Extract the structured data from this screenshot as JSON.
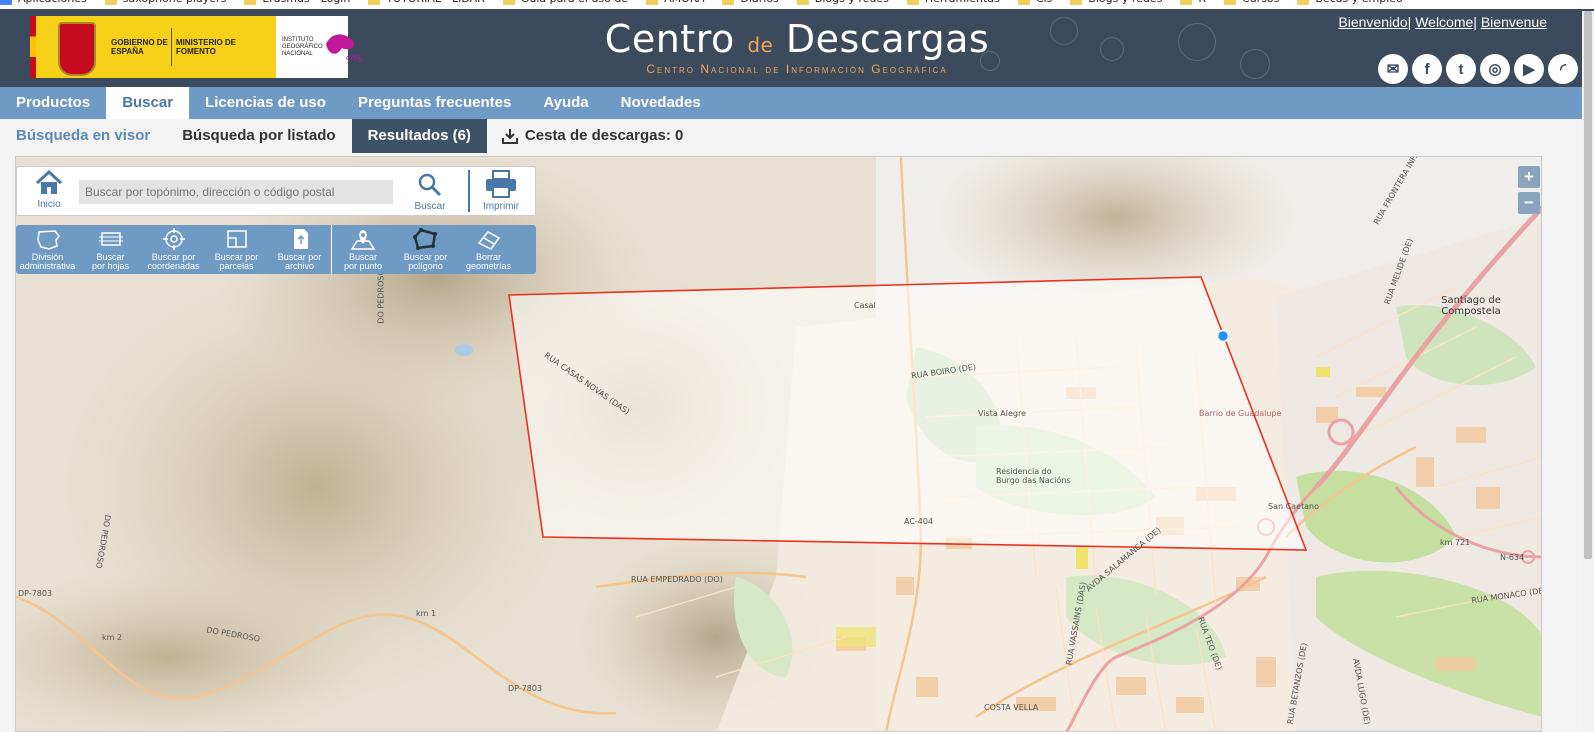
{
  "bookmarks": [
    "Aplicaciones",
    "saxophone players",
    "Erasmus - Login",
    "TUTORIAL - LIDAR",
    "Guía para el uso de",
    "AMORA",
    "Diarios",
    "Blogs y redes",
    "Herramientas",
    "Cis",
    "Blogs y redes",
    "R",
    "Cursos",
    "Becas y empleo"
  ],
  "header": {
    "logo_gobierno": "GOBIERNO DE ESPAÑA",
    "logo_ministerio": "MINISTERIO DE FOMENTO",
    "logo_ign": "INSTITUTO GEOGRÁFICO NACIONAL",
    "logo_cnig": "cnig",
    "title_a": "Centro",
    "title_de": "de",
    "title_b": "Descargas",
    "subtitle": "Centro Nacional de Información Geográfica",
    "languages": [
      "Bienvenido",
      "Welcome",
      "Bienvenue"
    ],
    "social": [
      {
        "icon": "mail-icon",
        "glyph": "✉"
      },
      {
        "icon": "facebook-icon",
        "glyph": "f"
      },
      {
        "icon": "twitter-icon",
        "glyph": "t"
      },
      {
        "icon": "instagram-icon",
        "glyph": "◎"
      },
      {
        "icon": "youtube-icon",
        "glyph": "▶"
      },
      {
        "icon": "rss-icon",
        "glyph": "◜"
      }
    ]
  },
  "mainnav": [
    {
      "label": "Productos",
      "active": false
    },
    {
      "label": "Buscar",
      "active": true
    },
    {
      "label": "Licencias de uso",
      "active": false
    },
    {
      "label": "Preguntas frecuentes",
      "active": false
    },
    {
      "label": "Ayuda",
      "active": false
    },
    {
      "label": "Novedades",
      "active": false
    }
  ],
  "subnav": {
    "visor": "Búsqueda en visor",
    "listado": "Búsqueda por listado",
    "resultados": "Resultados (6)",
    "cesta": "Cesta de descargas: 0"
  },
  "search": {
    "home_label": "Inicio",
    "placeholder": "Buscar por topónimo, dirección o código postal",
    "search_label": "Buscar",
    "print_label": "Imprimir"
  },
  "tools": [
    {
      "l1": "División",
      "l2": "administrativa",
      "icon": "spain-map-icon"
    },
    {
      "l1": "Buscar",
      "l2": "por hojas",
      "icon": "sheet-grid-icon"
    },
    {
      "l1": "Buscar por",
      "l2": "coordenadas",
      "icon": "crosshair-icon"
    },
    {
      "l1": "Buscar por",
      "l2": "parcelas",
      "icon": "parcel-icon"
    },
    {
      "l1": "Buscar por",
      "l2": "archivo",
      "icon": "file-icon"
    },
    {
      "l1": "Buscar",
      "l2": "por punto",
      "icon": "map-pin-icon"
    },
    {
      "l1": "Buscar por",
      "l2": "polígono",
      "icon": "polygon-icon"
    },
    {
      "l1": "Borrar",
      "l2": "geometrías",
      "icon": "eraser-icon"
    }
  ],
  "zoom": {
    "in": "+",
    "out": "−"
  },
  "map_labels": {
    "santiago": "Santiago de Compostela",
    "casas_novas": "RUA CASAS NOVAS (DAS)",
    "do_pedroso_top": "DO PEDROSO",
    "do_pedroso_left": "DO PEDROSO",
    "do_pedroso_bottom": "DO PEDROSO",
    "boiro": "RUA BOIRO (DE)",
    "vista_alegre": "Vista Alegre",
    "residencia": "Residencia do Burgo das Nacións",
    "barrio": "Barrio de Guadalupe",
    "san_caetano": "San Caetano",
    "empedrado": "RUA EMPEDRADO (DO)",
    "salamanca": "AVDA SALAMANCA (DE)",
    "vasgains": "RUA VASSAINS (DAS)",
    "teo": "RUA TEO (DE)",
    "betanzos": "RUA BETANZOS (DE)",
    "lugo": "AVDA LUGO (DE)",
    "costa_vella": "COSTA VELLA",
    "monaco": "RUA MONACO (DE)",
    "frontera": "RUA FRONTERA INF.",
    "melide": "RUA MELIDE (DE)",
    "ac404": "AC-404",
    "dp7803a": "DP-7803",
    "dp7803b": "DP-7803",
    "km1": "km 1",
    "km2": "km 2",
    "km721": "km 721",
    "n634": "N-634",
    "casal": "Casal"
  }
}
